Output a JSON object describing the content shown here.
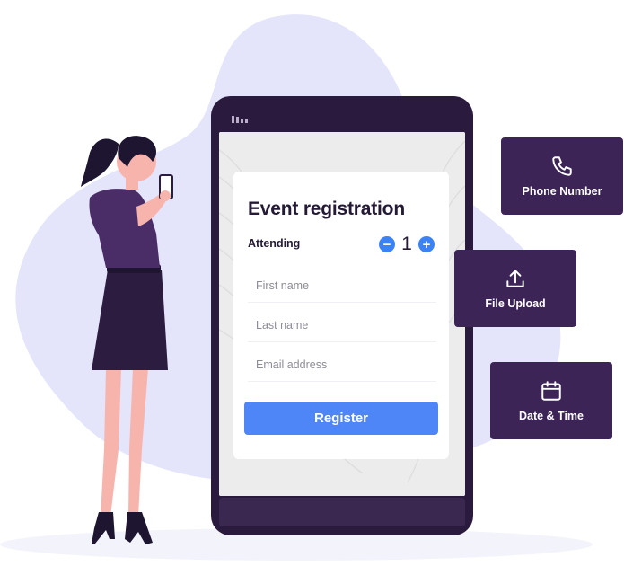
{
  "form": {
    "title": "Event registration",
    "attending_label": "Attending",
    "attending_count": "1",
    "decrement_symbol": "−",
    "increment_symbol": "+",
    "fields": [
      {
        "placeholder": "First name"
      },
      {
        "placeholder": "Last name"
      },
      {
        "placeholder": "Email address"
      }
    ],
    "submit_label": "Register"
  },
  "features": [
    {
      "label": "Phone Number",
      "icon": "phone-icon"
    },
    {
      "label": "File Upload",
      "icon": "upload-icon"
    },
    {
      "label": "Date & Time",
      "icon": "calendar-icon"
    }
  ],
  "colors": {
    "accent_blue": "#4f86f7",
    "feature_purple": "#3d2457",
    "phone_frame": "#2a1a3e",
    "blob_lavender": "#e4e4fb"
  }
}
